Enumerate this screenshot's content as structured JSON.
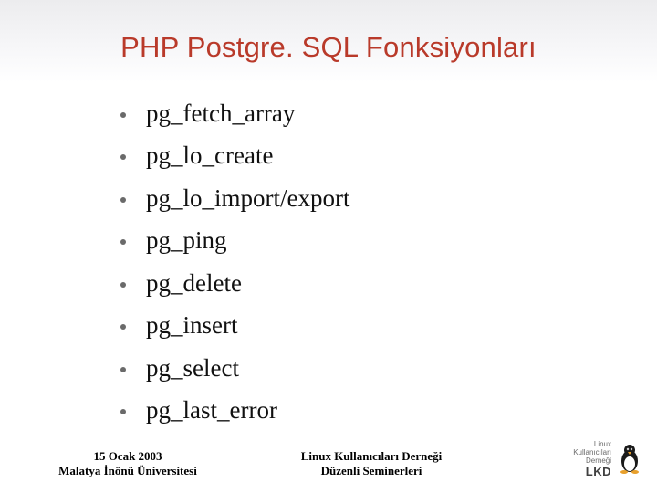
{
  "title": "PHP Postgre. SQL Fonksiyonları",
  "items": [
    "pg_fetch_array",
    "pg_lo_create",
    "pg_lo_import/export",
    "pg_ping",
    "pg_delete",
    "pg_insert",
    "pg_select",
    "pg_last_error"
  ],
  "footer": {
    "left_line1": "15 Ocak 2003",
    "left_line2": "Malatya İnönü Üniversitesi",
    "center_line1": "Linux Kullanıcıları Derneği",
    "center_line2": "Düzenli Seminerleri",
    "logo_line1": "Linux",
    "logo_line2": "Kullanıcıları",
    "logo_line3": "Derneği",
    "logo_org": "LKD"
  }
}
